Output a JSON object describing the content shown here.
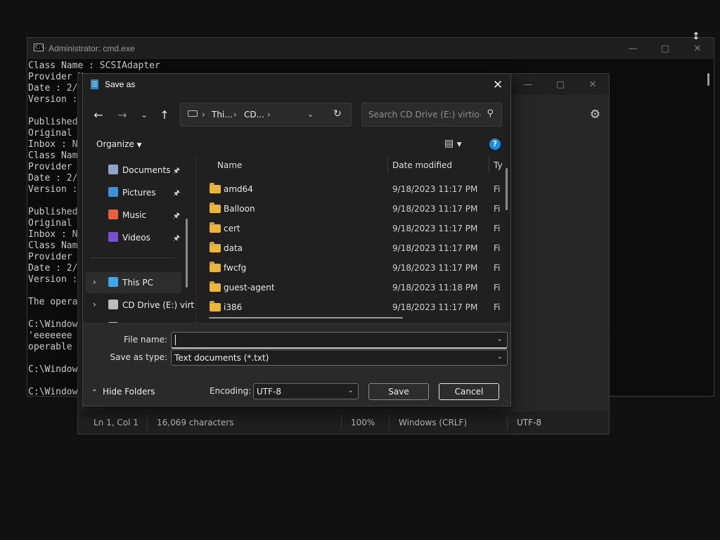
{
  "cmd": {
    "title": "Administrator: cmd.exe",
    "icon_text": "C:\\.",
    "lines": [
      "Class Name : SCSIAdapter",
      "Provider N",
      "Date : 2/",
      "Version :",
      "",
      "Published",
      "Original",
      "Inbox : N",
      "Class Nam",
      "Provider",
      "Date : 2/",
      "Version :",
      "",
      "Published",
      "Original",
      "Inbox : N",
      "Class Nam",
      "Provider",
      "Date : 2/",
      "Version :",
      "",
      "The opera",
      "",
      "C:\\Window",
      "'eeeeeee",
      "operable",
      "",
      "C:\\Window",
      "",
      "C:\\Window"
    ],
    "dashes": "-----"
  },
  "notepad": {
    "status": {
      "position": "Ln 1, Col 1",
      "characters": "16,069 characters",
      "zoom": "100%",
      "line_endings": "Windows (CRLF)",
      "encoding": "UTF-8"
    }
  },
  "dialog": {
    "title": "Save as",
    "breadcrumb": [
      "Thi...",
      "CD..."
    ],
    "search_placeholder": "Search CD Drive (E:) virtio-...",
    "organize_label": "Organize",
    "help_label": "?",
    "nav_items": [
      {
        "label": "Documents",
        "icon": "documents-icon",
        "color": "#8fa3c9",
        "pinned": true
      },
      {
        "label": "Pictures",
        "icon": "pictures-icon",
        "color": "#3d8fd6",
        "pinned": true
      },
      {
        "label": "Music",
        "icon": "music-icon",
        "color": "#e8613c",
        "pinned": true
      },
      {
        "label": "Videos",
        "icon": "videos-icon",
        "color": "#7a4fd1",
        "pinned": true
      },
      {
        "label": "This PC",
        "icon": "this-pc-icon",
        "color": "#3fa7e8"
      },
      {
        "label": "CD Drive (E:) virt",
        "icon": "cd-drive-icon",
        "color": "#bbbbbb"
      },
      {
        "label": "USB Drive (D:)",
        "icon": "usb-drive-icon",
        "color": "#bbbbbb"
      }
    ],
    "columns": {
      "name": "Name",
      "date": "Date modified",
      "type": "Ty"
    },
    "files": [
      {
        "name": "amd64",
        "date": "9/18/2023 11:17 PM",
        "type": "Fi"
      },
      {
        "name": "Balloon",
        "date": "9/18/2023 11:17 PM",
        "type": "Fi"
      },
      {
        "name": "cert",
        "date": "9/18/2023 11:17 PM",
        "type": "Fi"
      },
      {
        "name": "data",
        "date": "9/18/2023 11:17 PM",
        "type": "Fi"
      },
      {
        "name": "fwcfg",
        "date": "9/18/2023 11:17 PM",
        "type": "Fi"
      },
      {
        "name": "guest-agent",
        "date": "9/18/2023 11:18 PM",
        "type": "Fi"
      },
      {
        "name": "i386",
        "date": "9/18/2023 11:17 PM",
        "type": "Fi"
      }
    ],
    "file_name_label": "File name:",
    "file_name_value": "",
    "save_type_label": "Save as type:",
    "save_type_value": "Text documents (*.txt)",
    "hide_folders_label": "Hide Folders",
    "encoding_label": "Encoding:",
    "encoding_value": "UTF-8",
    "save_label": "Save",
    "cancel_label": "Cancel"
  },
  "colors": {
    "background": "#111111",
    "folder": "#e8b63c",
    "help_blue": "#1b8de0",
    "window": "#202020"
  }
}
